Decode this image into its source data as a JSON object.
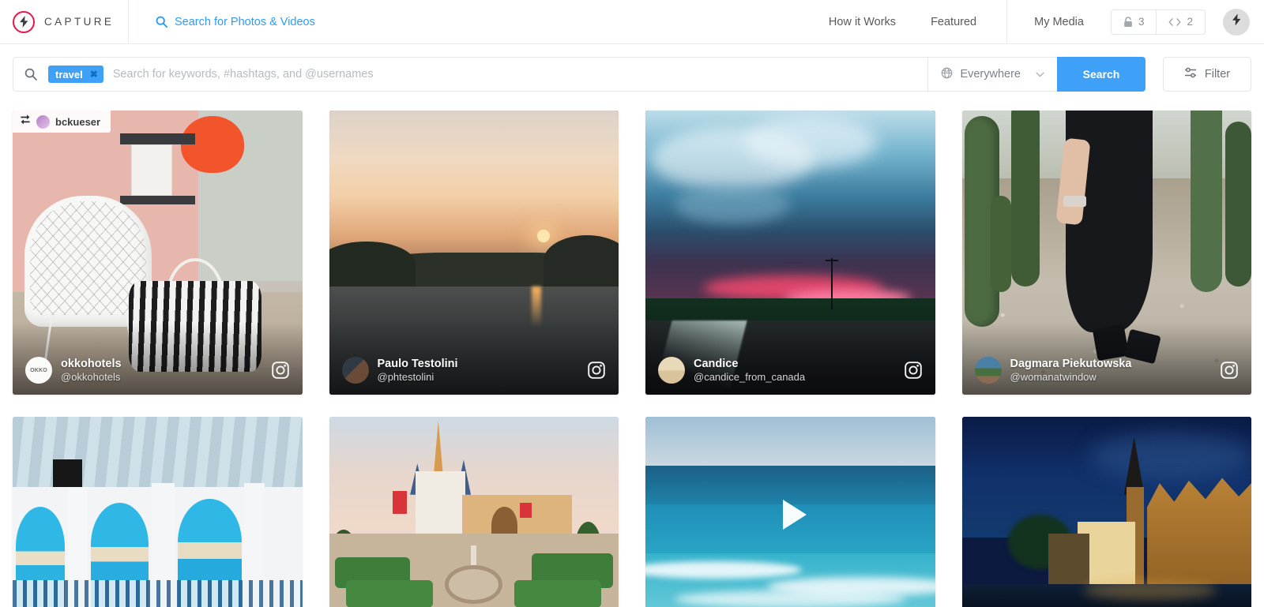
{
  "header": {
    "logo_icon": "lightning-bolt-icon",
    "brand_name": "CAPTURE",
    "search_link_label": "Search for Photos & Videos",
    "search_link_icon": "search-icon",
    "nav": [
      {
        "label": "How it Works"
      },
      {
        "label": "Featured"
      }
    ],
    "my_media_label": "My Media",
    "counters": [
      {
        "icon": "lock-icon",
        "value": "3"
      },
      {
        "icon": "code-brackets-icon",
        "value": "2"
      }
    ],
    "avatar_icon": "lightning-bolt-icon"
  },
  "search": {
    "icon": "search-icon",
    "chips": [
      {
        "label": "travel",
        "remove_icon": "close-icon"
      }
    ],
    "placeholder": "Search for keywords, #hashtags, and @usernames",
    "value": "",
    "scope": {
      "icon": "globe-icon",
      "label": "Everywhere",
      "chevron_icon": "chevron-down-icon"
    },
    "search_button_label": "Search",
    "filter_button_label": "Filter",
    "filter_icon": "sliders-icon",
    "accent_color": "#3fa0f7"
  },
  "results": {
    "row1": [
      {
        "scene": "p1",
        "repost": {
          "icon": "repost-icon",
          "username": "bckueser",
          "avatar": "bckueser-avatar"
        },
        "user_name": "okkohotels",
        "user_handle": "@okkohotels",
        "avatar_label": "OKKO",
        "avatar_class": "av-okko",
        "source_icon": "instagram-icon",
        "is_video": false
      },
      {
        "scene": "p2",
        "repost": null,
        "user_name": "Paulo Testolini",
        "user_handle": "@phtestolini",
        "avatar_label": "",
        "avatar_class": "av-paulo",
        "source_icon": "instagram-icon",
        "is_video": false
      },
      {
        "scene": "p3",
        "repost": null,
        "user_name": "Candice",
        "user_handle": "@candice_from_canada",
        "avatar_label": "",
        "avatar_class": "av-candice",
        "source_icon": "instagram-icon",
        "is_video": false
      },
      {
        "scene": "p4",
        "repost": null,
        "user_name": "Dagmara Piekutowska",
        "user_handle": "@womanatwindow",
        "avatar_label": "",
        "avatar_class": "av-dagmara",
        "source_icon": "instagram-icon",
        "is_video": false
      }
    ],
    "row2": [
      {
        "scene": "p5",
        "is_video": false,
        "play_icon": ""
      },
      {
        "scene": "p6",
        "is_video": false,
        "play_icon": ""
      },
      {
        "scene": "p7",
        "is_video": true,
        "play_icon": "play-icon"
      },
      {
        "scene": "p8",
        "is_video": false,
        "play_icon": ""
      }
    ]
  }
}
